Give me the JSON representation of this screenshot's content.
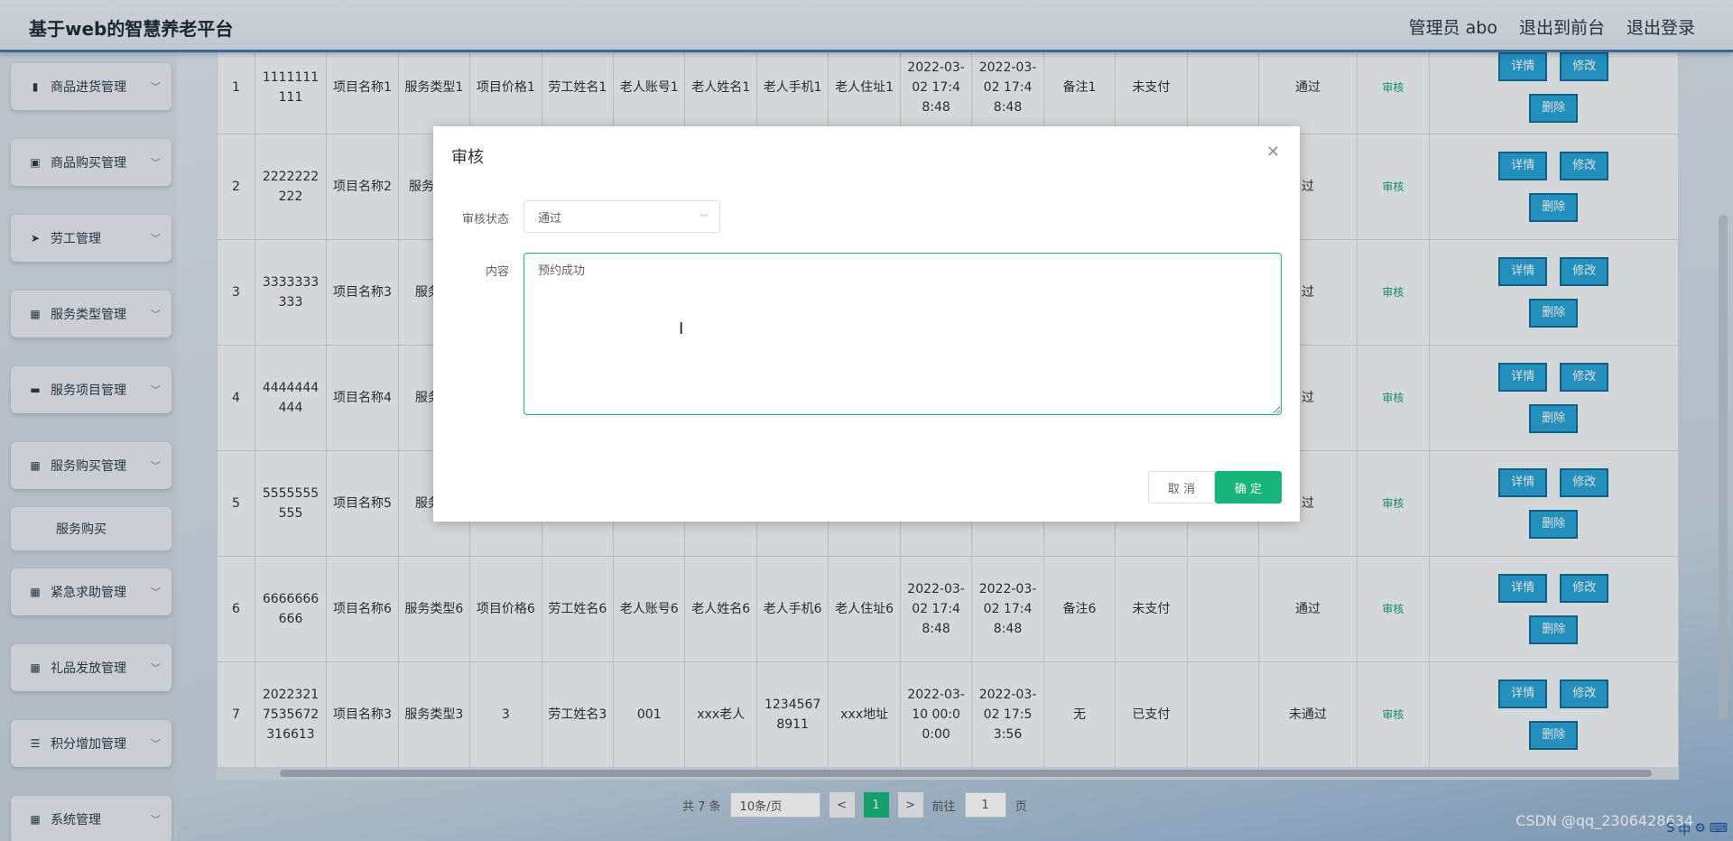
{
  "app": {
    "title": "基于web的智慧养老平台"
  },
  "header": {
    "nav": [
      "管理员 abo",
      "退出到前台",
      "退出登录"
    ]
  },
  "sidebar": {
    "items": [
      {
        "label": "商品进货管理",
        "icon": "bar-chart-icon"
      },
      {
        "label": "商品购买管理",
        "icon": "clipboard-icon"
      },
      {
        "label": "劳工管理",
        "icon": "send-icon"
      },
      {
        "label": "服务类型管理",
        "icon": "grid-icon"
      },
      {
        "label": "服务项目管理",
        "icon": "monitor-icon"
      },
      {
        "label": "服务购买管理",
        "icon": "grid-icon"
      },
      {
        "label": "紧急求助管理",
        "icon": "grid-icon"
      },
      {
        "label": "礼品发放管理",
        "icon": "grid-icon"
      },
      {
        "label": "积分增加管理",
        "icon": "list-icon"
      },
      {
        "label": "系统管理",
        "icon": "grid-icon"
      }
    ],
    "submenu": {
      "label": "服务购买"
    }
  },
  "table": {
    "rows": [
      {
        "idx": "1",
        "no": "1111111111",
        "item": "项目名称1",
        "type": "服务类型1",
        "price": "项目价格1",
        "worker": "劳工姓名1",
        "account": "老人账号1",
        "name": "老人姓名1",
        "phone": "老人手机1",
        "addr": "老人住址1",
        "t1": "2022-03-02 17:48:48",
        "t2": "2022-03-02 17:48:48",
        "note": "备注1",
        "pay": "未支付",
        "status": "通过"
      },
      {
        "idx": "2",
        "no": "2222222222",
        "item": "项目名称2",
        "type": "服务类型",
        "price": "",
        "worker": "",
        "account": "",
        "name": "",
        "phone": "",
        "addr": "",
        "t1": "",
        "t2": "",
        "note": "",
        "pay": "",
        "status": "过"
      },
      {
        "idx": "3",
        "no": "3333333333",
        "item": "项目名称3",
        "type": "服务类",
        "price": "",
        "worker": "",
        "account": "",
        "name": "",
        "phone": "",
        "addr": "",
        "t1": "",
        "t2": "",
        "note": "",
        "pay": "",
        "status": "过"
      },
      {
        "idx": "4",
        "no": "4444444444",
        "item": "项目名称4",
        "type": "服务类",
        "price": "",
        "worker": "",
        "account": "",
        "name": "",
        "phone": "",
        "addr": "",
        "t1": "",
        "t2": "",
        "note": "",
        "pay": "",
        "status": "过"
      },
      {
        "idx": "5",
        "no": "5555555555",
        "item": "项目名称5",
        "type": "服务类",
        "price": "",
        "worker": "",
        "account": "",
        "name": "",
        "phone": "",
        "addr": "",
        "t1": "8:48",
        "t2": "8:48",
        "note": "",
        "pay": "",
        "status": "过"
      },
      {
        "idx": "6",
        "no": "6666666666",
        "item": "项目名称6",
        "type": "服务类型6",
        "price": "项目价格6",
        "worker": "劳工姓名6",
        "account": "老人账号6",
        "name": "老人姓名6",
        "phone": "老人手机6",
        "addr": "老人住址6",
        "t1": "2022-03-02 17:48:48",
        "t2": "2022-03-02 17:48:48",
        "note": "备注6",
        "pay": "未支付",
        "status": "通过"
      },
      {
        "idx": "7",
        "no": "20223217535672316613",
        "item": "项目名称3",
        "type": "服务类型3",
        "price": "3",
        "worker": "劳工姓名3",
        "account": "001",
        "name": "xxx老人",
        "phone": "12345678911",
        "addr": "xxx地址",
        "t1": "2022-03-10 00:00:00",
        "t2": "2022-03-02 17:53:56",
        "note": "无",
        "pay": "已支付",
        "status": "未通过"
      }
    ],
    "ops": {
      "audit": "审核",
      "detail": "详情",
      "edit": "修改",
      "delete": "删除"
    }
  },
  "pager": {
    "total": "共 7 条",
    "size": "10条/页",
    "prev": "<",
    "current": "1",
    "next": ">",
    "goto": "前往",
    "goto_value": "1",
    "page_unit": "页"
  },
  "dialog": {
    "title": "审核",
    "status_label": "审核状态",
    "status_value": "通过",
    "content_label": "内容",
    "content_value": "预约成功",
    "cancel": "取 消",
    "confirm": "确 定"
  },
  "watermark": "CSDN @qq_2306428634",
  "colors": {
    "accent": "#17b57a",
    "op_button": "#27a3d8",
    "header_border": "#3f78a8"
  }
}
